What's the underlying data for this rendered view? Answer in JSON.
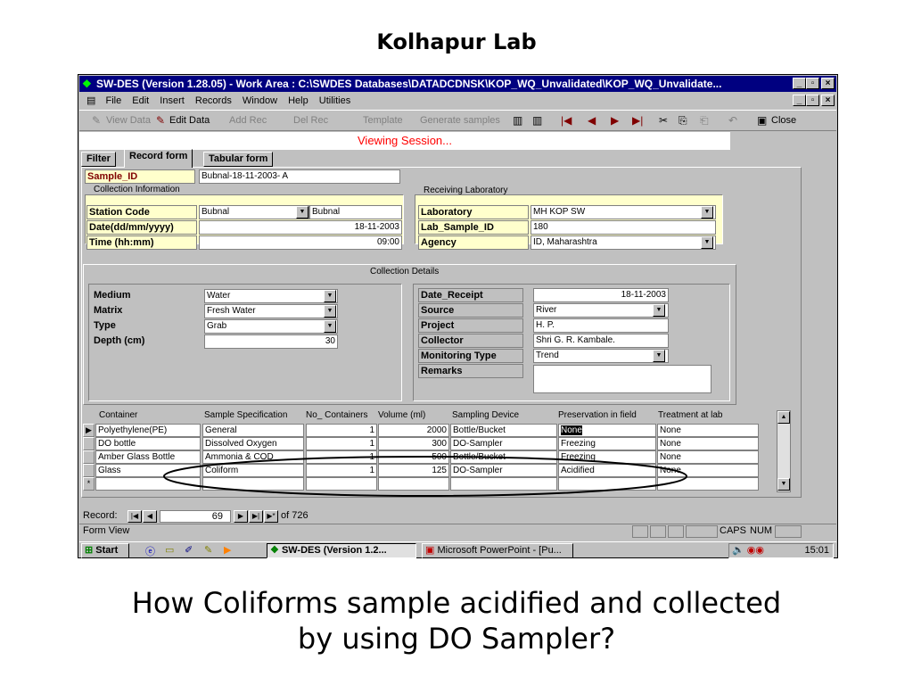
{
  "slide": {
    "title": "Kolhapur Lab",
    "caption_line1": "How Coliforms sample acidified and collected",
    "caption_line2": "by using DO Sampler?"
  },
  "window": {
    "title": "SW-DES (Version 1.28.05) - Work Area : C:\\SWDES Databases\\DATADCDNSK\\KOP_WQ_Unvalidated\\KOP_WQ_Unvalidate...",
    "menus": [
      "File",
      "Edit",
      "Insert",
      "Records",
      "Window",
      "Help",
      "Utilities"
    ],
    "toolbar": {
      "view_data": "View Data",
      "edit_data": "Edit Data",
      "add_rec": "Add Rec",
      "del_rec": "Del Rec",
      "template": "Template",
      "generate": "Generate samples",
      "close": "Close"
    },
    "session": "Viewing Session...",
    "tabs": [
      "Filter",
      "Record form",
      "Tabular form"
    ]
  },
  "form": {
    "sample_id_label": "Sample_ID",
    "sample_id_value": "Bubnal-18-11-2003- A",
    "collection_info_label": "Collection Information",
    "receiving_lab_label": "Receiving Laboratory",
    "station_code_label": "Station Code",
    "station_code_value": "Bubnal",
    "station_name_value": "Bubnal",
    "date_label": "Date(dd/mm/yyyy)",
    "date_value": "18-11-2003",
    "time_label": "Time (hh:mm)",
    "time_value": "09:00",
    "laboratory_label": "Laboratory",
    "laboratory_value": "MH KOP SW",
    "lab_sample_id_label": "Lab_Sample_ID",
    "lab_sample_id_value": "180",
    "agency_label": "Agency",
    "agency_value": "ID, Maharashtra",
    "collection_details_label": "Collection Details",
    "medium_label": "Medium",
    "medium_value": "Water",
    "matrix_label": "Matrix",
    "matrix_value": "Fresh Water",
    "type_label": "Type",
    "type_value": "Grab",
    "depth_label": "Depth (cm)",
    "depth_value": "30",
    "date_receipt_label": "Date_Receipt",
    "date_receipt_value": "18-11-2003",
    "source_label": "Source",
    "source_value": "River",
    "project_label": "Project",
    "project_value": "H. P.",
    "collector_label": "Collector",
    "collector_value": "Shri G. R. Kambale.",
    "monitoring_type_label": "Monitoring Type",
    "monitoring_type_value": "Trend",
    "remarks_label": "Remarks",
    "remarks_value": ""
  },
  "grid": {
    "headers": [
      "Container",
      "Sample Specification",
      "No_ Containers",
      "Volume (ml)",
      "Sampling Device",
      "Preservation in field",
      "Treatment at lab"
    ],
    "rows": [
      [
        "Polyethylene(PE)",
        "General",
        "1",
        "2000",
        "Bottle/Bucket",
        "None",
        "None"
      ],
      [
        "DO bottle",
        "Dissolved Oxygen",
        "1",
        "300",
        "DO-Sampler",
        "Freezing",
        "None"
      ],
      [
        "Amber Glass Bottle",
        "Ammonia & COD",
        "1",
        "500",
        "Bottle/Bucket",
        "Freezing",
        "None"
      ],
      [
        "Glass",
        "Coliform",
        "1",
        "125",
        "DO-Sampler",
        "Acidified",
        "None"
      ]
    ],
    "new_row_marker": "*",
    "current_row_marker": "▶"
  },
  "record_nav": {
    "label": "Record:",
    "current": "69",
    "of_text": "of  726"
  },
  "statusbar": {
    "view": "Form View",
    "caps": "CAPS",
    "num": "NUM"
  },
  "taskbar": {
    "start": "Start",
    "task1": "SW-DES (Version 1.2...",
    "task2": "Microsoft PowerPoint - [Pu...",
    "clock": "15:01"
  },
  "colors": {
    "titlebar": "#000080",
    "session_text": "#ff0000",
    "label_bg": "#ffffcc",
    "chrome": "#c0c0c0"
  }
}
